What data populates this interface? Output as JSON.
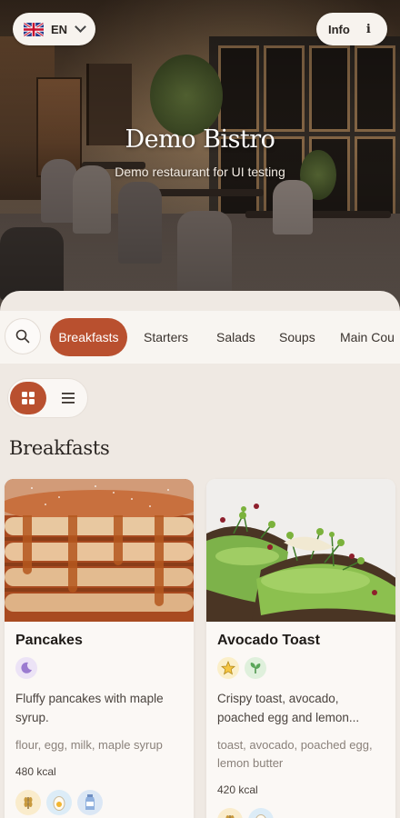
{
  "header": {
    "language": {
      "code": "EN",
      "flag": "uk-flag-icon"
    },
    "info_label": "Info",
    "info_icon": "i",
    "restaurant_name": "Demo Bistro",
    "tagline": "Demo restaurant for UI testing"
  },
  "categories": {
    "search_icon": "search-icon",
    "tabs": [
      {
        "label": "Breakfasts",
        "active": true
      },
      {
        "label": "Starters",
        "active": false
      },
      {
        "label": "Salads",
        "active": false
      },
      {
        "label": "Soups",
        "active": false
      },
      {
        "label": "Main Cou",
        "active": false
      }
    ]
  },
  "view_toggle": {
    "selected": "grid",
    "options": [
      "grid-icon",
      "list-icon"
    ]
  },
  "section": {
    "title": "Breakfasts"
  },
  "dishes": [
    {
      "name": "Pancakes",
      "tags": [
        "moon-icon"
      ],
      "description": "Fluffy pancakes with maple syrup.",
      "ingredients": "flour, egg, milk, maple syrup",
      "kcal": "480 kcal",
      "allergens": [
        "wheat-icon",
        "egg-icon",
        "milk-icon"
      ]
    },
    {
      "name": "Avocado Toast",
      "tags": [
        "star-icon",
        "leaf-icon"
      ],
      "description": "Crispy toast, avocado, poached egg and lemon...",
      "ingredients": "toast, avocado, poached egg, lemon butter",
      "kcal": "420 kcal",
      "allergens": [
        "wheat-icon",
        "egg-icon"
      ]
    }
  ],
  "colors": {
    "accent": "#b9502f",
    "background": "#efe9e3",
    "card": "#fbf8f5"
  }
}
